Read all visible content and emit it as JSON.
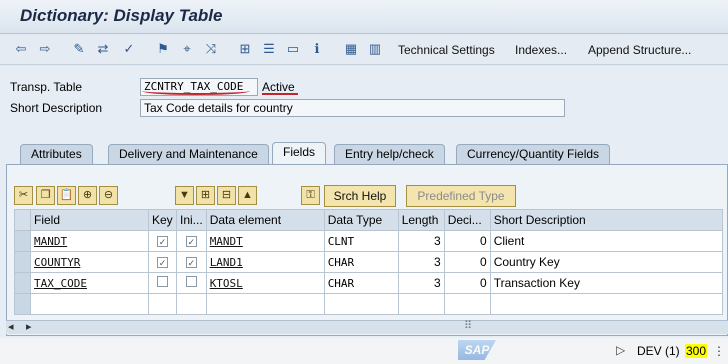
{
  "title": "Dictionary: Display Table",
  "toolbar": {
    "icons": [
      "back-icon",
      "forward-icon",
      "pencil-icon",
      "toggle-display-icon",
      "check-icon",
      "activate-icon",
      "where-used-icon",
      "hierarchy-icon",
      "graphic-icon",
      "object-list-icon",
      "info-icon",
      "layout-icon",
      "table-icon"
    ],
    "technical_settings": "Technical Settings",
    "indexes": "Indexes...",
    "append_structure": "Append Structure..."
  },
  "header": {
    "transp_table_label": "Transp. Table",
    "transp_table_value": "ZCNTRY_TAX_CODE",
    "status": "Active",
    "short_desc_label": "Short Description",
    "short_desc_value": "Tax Code details for country"
  },
  "tabs": [
    {
      "label": "Attributes",
      "active": false
    },
    {
      "label": "Delivery and Maintenance",
      "active": false
    },
    {
      "label": "Fields",
      "active": true
    },
    {
      "label": "Entry help/check",
      "active": false
    },
    {
      "label": "Currency/Quantity Fields",
      "active": false
    }
  ],
  "buttons": {
    "srch_help": "Srch Help",
    "predefined_type": "Predefined Type"
  },
  "grid": {
    "columns": [
      "Field",
      "Key",
      "Ini...",
      "Data element",
      "Data Type",
      "Length",
      "Deci...",
      "Short Description"
    ],
    "rows": [
      {
        "field": "MANDT",
        "key": true,
        "ini": true,
        "data_element": "MANDT",
        "data_type": "CLNT",
        "length": "3",
        "deci": "0",
        "desc": "Client"
      },
      {
        "field": "COUNTYR",
        "key": true,
        "ini": true,
        "data_element": "LAND1",
        "data_type": "CHAR",
        "length": "3",
        "deci": "0",
        "desc": "Country Key"
      },
      {
        "field": "TAX_CODE",
        "key": false,
        "ini": false,
        "data_element": "KTOSL",
        "data_type": "CHAR",
        "length": "3",
        "deci": "0",
        "desc": "Transaction Key"
      }
    ]
  },
  "status_bar": {
    "system": "DEV (1)",
    "client": "300",
    "logo": "SAP"
  },
  "colors": {
    "accent": "#2f5a8e",
    "underline": "#c0262d",
    "highlight": "#ffff00"
  }
}
